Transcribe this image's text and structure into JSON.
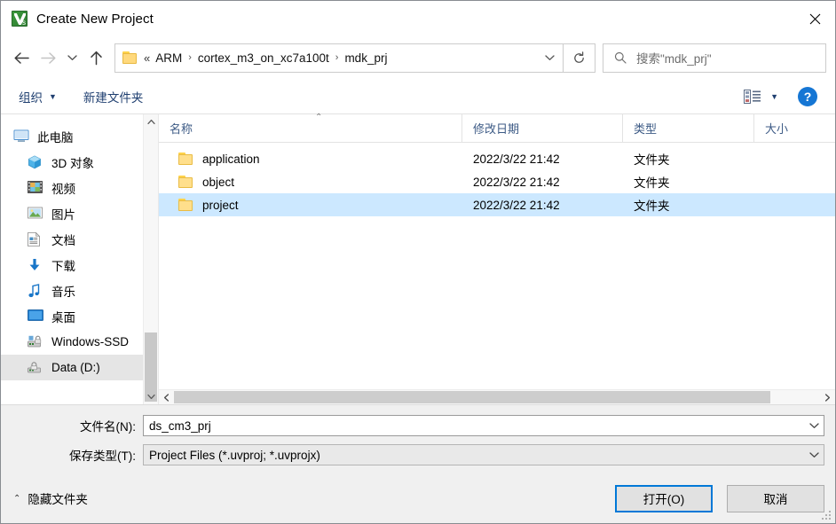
{
  "window": {
    "title": "Create New Project",
    "app_icon": "uvision-icon",
    "close_label": "✕"
  },
  "nav": {
    "back": "back-arrow",
    "forward": "forward-arrow",
    "recent": "recent-locations-chevron",
    "up": "up-arrow",
    "address": {
      "leading": "«",
      "crumbs": [
        "ARM",
        "cortex_m3_on_xc7a100t",
        "mdk_prj"
      ],
      "separator": "›",
      "dropdown": "chevron-down",
      "refresh": "refresh-icon"
    },
    "search": {
      "placeholder": "搜索\"mdk_prj\"",
      "icon": "search-icon"
    }
  },
  "commandbar": {
    "organize": "组织",
    "new_folder": "新建文件夹",
    "view_icon": "view-options-icon",
    "help": "?"
  },
  "sidebar": {
    "items": [
      {
        "label": "此电脑",
        "icon": "this-pc-icon",
        "root": true,
        "hover": false
      },
      {
        "label": "3D 对象",
        "icon": "3d-objects-icon",
        "root": false,
        "hover": false
      },
      {
        "label": "视频",
        "icon": "videos-icon",
        "root": false,
        "hover": false
      },
      {
        "label": "图片",
        "icon": "pictures-icon",
        "root": false,
        "hover": false
      },
      {
        "label": "文档",
        "icon": "documents-icon",
        "root": false,
        "hover": false
      },
      {
        "label": "下载",
        "icon": "downloads-icon",
        "root": false,
        "hover": false
      },
      {
        "label": "音乐",
        "icon": "music-icon",
        "root": false,
        "hover": false
      },
      {
        "label": "桌面",
        "icon": "desktop-icon",
        "root": false,
        "hover": false
      },
      {
        "label": "Windows-SSD",
        "icon": "drive-icon",
        "root": false,
        "hover": false
      },
      {
        "label": "Data (D:)",
        "icon": "drive-icon",
        "root": false,
        "hover": true
      }
    ]
  },
  "filelist": {
    "columns": [
      {
        "label": "名称",
        "sorted": "asc"
      },
      {
        "label": "修改日期",
        "sorted": ""
      },
      {
        "label": "类型",
        "sorted": ""
      },
      {
        "label": "大小",
        "sorted": ""
      }
    ],
    "sort_caret": "⌃",
    "rows": [
      {
        "name": "application",
        "date": "2022/3/22 21:42",
        "type": "文件夹",
        "size": "",
        "selected": false,
        "icon": "folder-icon"
      },
      {
        "name": "object",
        "date": "2022/3/22 21:42",
        "type": "文件夹",
        "size": "",
        "selected": false,
        "icon": "folder-icon"
      },
      {
        "name": "project",
        "date": "2022/3/22 21:42",
        "type": "文件夹",
        "size": "",
        "selected": true,
        "icon": "folder-icon"
      }
    ]
  },
  "fields": {
    "filename_label": "文件名(N):",
    "filename_value": "ds_cm3_prj",
    "filetype_label": "保存类型(T):",
    "filetype_value": "Project Files (*.uvproj; *.uvprojx)"
  },
  "footer": {
    "hide_folders": "隐藏文件夹",
    "hide_caret": "⌃",
    "open_button": "打开(O)",
    "cancel_button": "取消"
  },
  "colors": {
    "accent": "#0078d7",
    "selection": "#cce8ff",
    "crumb_link": "#1f3f70",
    "folder_yellow": "#ffdf8c"
  }
}
